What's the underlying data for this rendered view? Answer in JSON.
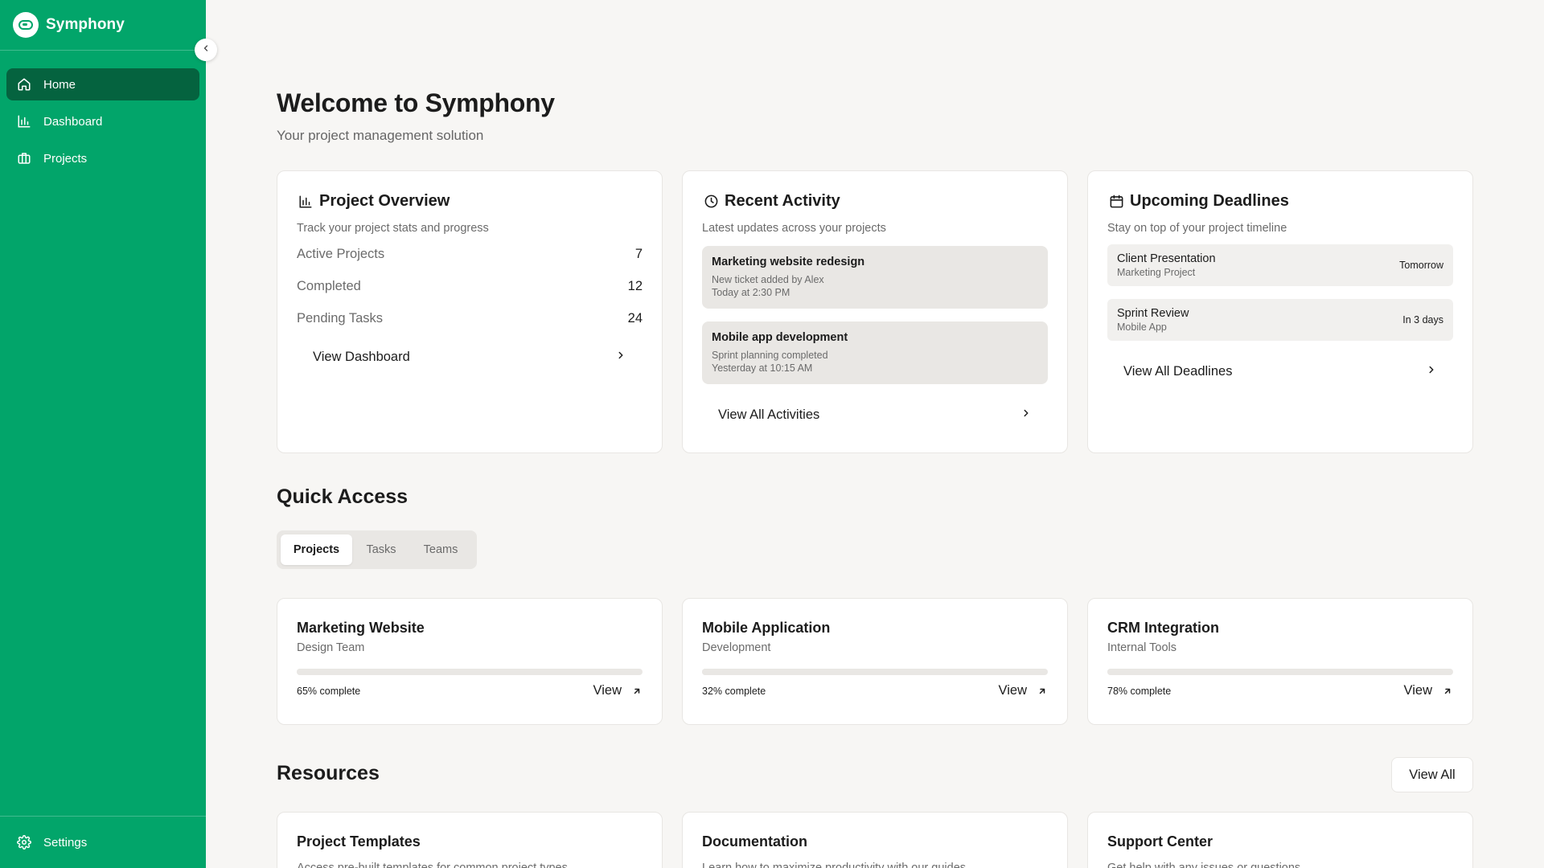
{
  "app": {
    "name": "Symphony",
    "brand_color": "#02a56a"
  },
  "sidebar": {
    "items": [
      {
        "label": "Home",
        "icon": "home-icon",
        "active": true
      },
      {
        "label": "Dashboard",
        "icon": "bar-chart-icon",
        "active": false
      },
      {
        "label": "Projects",
        "icon": "briefcase-icon",
        "active": false
      }
    ],
    "settings_label": "Settings"
  },
  "header": {
    "title": "Welcome to Symphony",
    "subtitle": "Your project management solution"
  },
  "overview": {
    "title": "Project Overview",
    "description": "Track your project stats and progress",
    "stats": [
      {
        "label": "Active Projects",
        "value": "7"
      },
      {
        "label": "Completed",
        "value": "12"
      },
      {
        "label": "Pending Tasks",
        "value": "24"
      }
    ],
    "link_label": "View Dashboard"
  },
  "activity": {
    "title": "Recent Activity",
    "description": "Latest updates across your projects",
    "items": [
      {
        "title": "Marketing website redesign",
        "detail": "New ticket added by Alex",
        "time": "Today at 2:30 PM"
      },
      {
        "title": "Mobile app development",
        "detail": "Sprint planning completed",
        "time": "Yesterday at 10:15 AM"
      }
    ],
    "link_label": "View All Activities"
  },
  "deadlines": {
    "title": "Upcoming Deadlines",
    "description": "Stay on top of your project timeline",
    "items": [
      {
        "title": "Client Presentation",
        "project": "Marketing Project",
        "when": "Tomorrow"
      },
      {
        "title": "Sprint Review",
        "project": "Mobile App",
        "when": "In 3 days"
      }
    ],
    "link_label": "View All Deadlines"
  },
  "quick_access": {
    "title": "Quick Access",
    "tabs": [
      "Projects",
      "Tasks",
      "Teams"
    ],
    "active_tab": "Projects",
    "projects": [
      {
        "name": "Marketing Website",
        "team": "Design Team",
        "progress": 0.65,
        "progress_label": "65% complete",
        "view_label": "View"
      },
      {
        "name": "Mobile Application",
        "team": "Development",
        "progress": 0.32,
        "progress_label": "32% complete",
        "view_label": "View"
      },
      {
        "name": "CRM Integration",
        "team": "Internal Tools",
        "progress": 0.78,
        "progress_label": "78% complete",
        "view_label": "View"
      }
    ]
  },
  "resources": {
    "title": "Resources",
    "view_all_label": "View All",
    "items": [
      {
        "title": "Project Templates",
        "description": "Access pre-built templates for common project types"
      },
      {
        "title": "Documentation",
        "description": "Learn how to maximize productivity with our guides"
      },
      {
        "title": "Support Center",
        "description": "Get help with any issues or questions"
      }
    ]
  }
}
